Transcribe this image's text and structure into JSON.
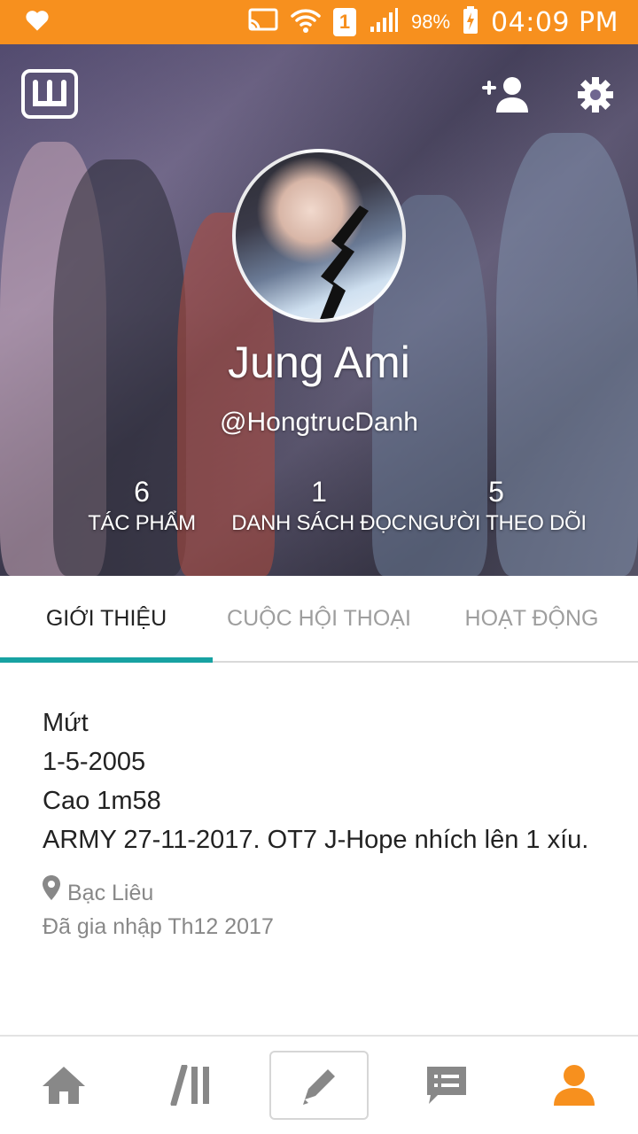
{
  "status_bar": {
    "battery_percent": "98%",
    "time": "04:09 PM",
    "sim_slot": "1",
    "icons": [
      "heart-icon",
      "cast-icon",
      "wifi-icon",
      "signal-icon",
      "battery-charging-icon"
    ]
  },
  "header": {
    "display_name": "Jung Ami",
    "username": "@HongtrucDanh",
    "stats": [
      {
        "value": "6",
        "label": "TÁC PHẨM"
      },
      {
        "value": "1",
        "label": "DANH SÁCH ĐỌC"
      },
      {
        "value": "5",
        "label": "NGƯỜI THEO DÕI"
      }
    ]
  },
  "tabs": [
    {
      "label": "GIỚI THIỆU",
      "active": true
    },
    {
      "label": "CUỘC HỘI THOẠI",
      "active": false
    },
    {
      "label": "HOẠT ĐỘNG",
      "active": false
    }
  ],
  "about": {
    "bio_lines": [
      "Mứt",
      "1-5-2005",
      "Cao 1m58",
      "ARMY 27-11-2017. OT7 J-Hope nhích lên 1 xíu."
    ],
    "location": "Bạc Liêu",
    "joined": "Đã gia nhập Th12 2017"
  },
  "bottom_nav": [
    "home-icon",
    "library-icon",
    "write-icon",
    "messages-icon",
    "profile-icon"
  ],
  "colors": {
    "status_bar": "#f7901e",
    "accent_teal": "#17a2a2",
    "active_nav": "#f7901e",
    "inactive_nav": "#888888"
  }
}
